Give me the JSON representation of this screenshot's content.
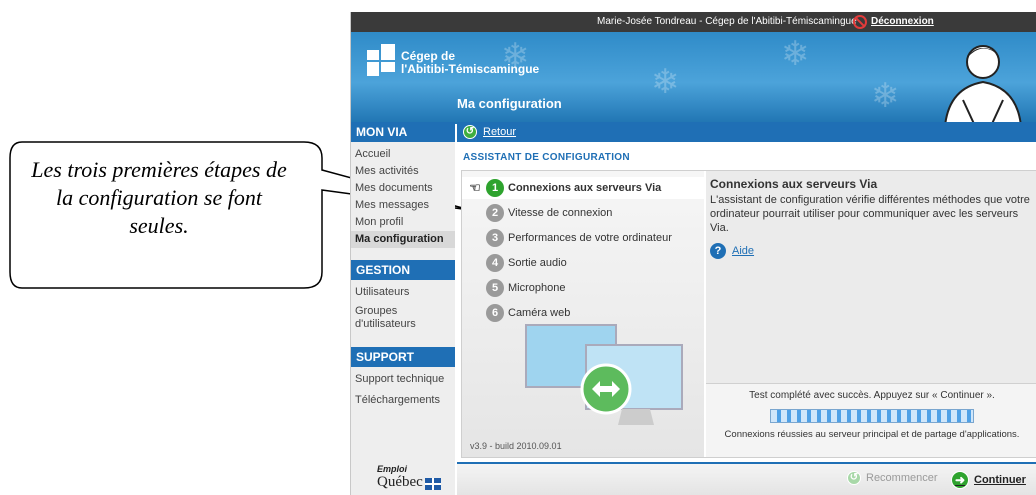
{
  "callout": {
    "text": "Les trois premières étapes de la configuration se font seules."
  },
  "topbar": {
    "user": "Marie-Josée Tondreau - Cégep de l'Abitibi-Témiscamingue",
    "logout": "Déconnexion"
  },
  "banner": {
    "logo_line1": "Cégep de",
    "logo_line2": "l'Abitibi-Témiscamingue",
    "title": "Ma configuration"
  },
  "sidebar": {
    "mon_via_header": "MON VIA",
    "mon_via_items": [
      "Accueil",
      "Mes activités",
      "Mes documents",
      "Mes messages",
      "Mon profil",
      "Ma configuration"
    ],
    "active_item": "Ma configuration",
    "gestion_header": "GESTION",
    "gestion_items": [
      "Utilisateurs",
      "Groupes",
      "d'utilisateurs"
    ],
    "support_header": "SUPPORT",
    "support_items": [
      "Support technique",
      "Téléchargements"
    ],
    "qc_logo": {
      "top": "Emploi",
      "main": "Québec"
    }
  },
  "main": {
    "back_label": "Retour",
    "section_title": "ASSISTANT DE CONFIGURATION",
    "steps": [
      {
        "num": "1",
        "label": "Connexions aux serveurs Via"
      },
      {
        "num": "2",
        "label": "Vitesse de connexion"
      },
      {
        "num": "3",
        "label": "Performances de votre ordinateur"
      },
      {
        "num": "4",
        "label": "Sortie audio"
      },
      {
        "num": "5",
        "label": "Microphone"
      },
      {
        "num": "6",
        "label": "Caméra web"
      }
    ],
    "version": "v3.9 - build 2010.09.01",
    "info_title": "Connexions aux serveurs Via",
    "info_body": "L'assistant de configuration vérifie différentes méthodes que votre ordinateur pourrait utiliser pour communiquer avec les serveurs Via.",
    "help_label": "Aide",
    "status_message": "Test complété avec succès. Appuyez sur « Continuer ».",
    "status_detail": "Connexions réussies au serveur principal et de partage d'applications.",
    "restart_label": "Recommencer",
    "continue_label": "Continuer"
  }
}
